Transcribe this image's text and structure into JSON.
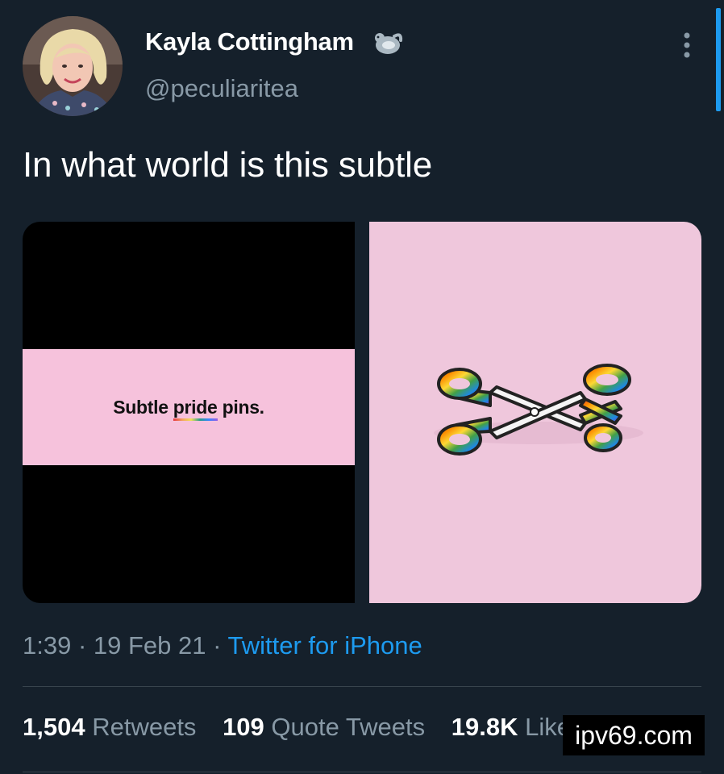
{
  "tweet": {
    "display_name": "Kayla Cottingham",
    "handle": "@peculiaritea",
    "text": "In what world is this subtle",
    "badge_icon": "otter-emoji-icon",
    "media": {
      "left_caption_prefix": "Subtle ",
      "left_caption_highlight": "pride",
      "left_caption_suffix": " pins."
    },
    "time": "1:39",
    "date": "19 Feb 21",
    "source": "Twitter for iPhone",
    "separator": " · "
  },
  "stats": {
    "retweets_count": "1,504",
    "retweets_label": "Retweets",
    "quotes_count": "109",
    "quotes_label": "Quote Tweets",
    "likes_count": "19.8K",
    "likes_label": "Likes"
  },
  "watermark": "ipv69.com",
  "colors": {
    "background": "#15202b",
    "secondary_text": "#8899a6",
    "accent": "#1d9bf0",
    "pink": "#f6c2dc"
  }
}
